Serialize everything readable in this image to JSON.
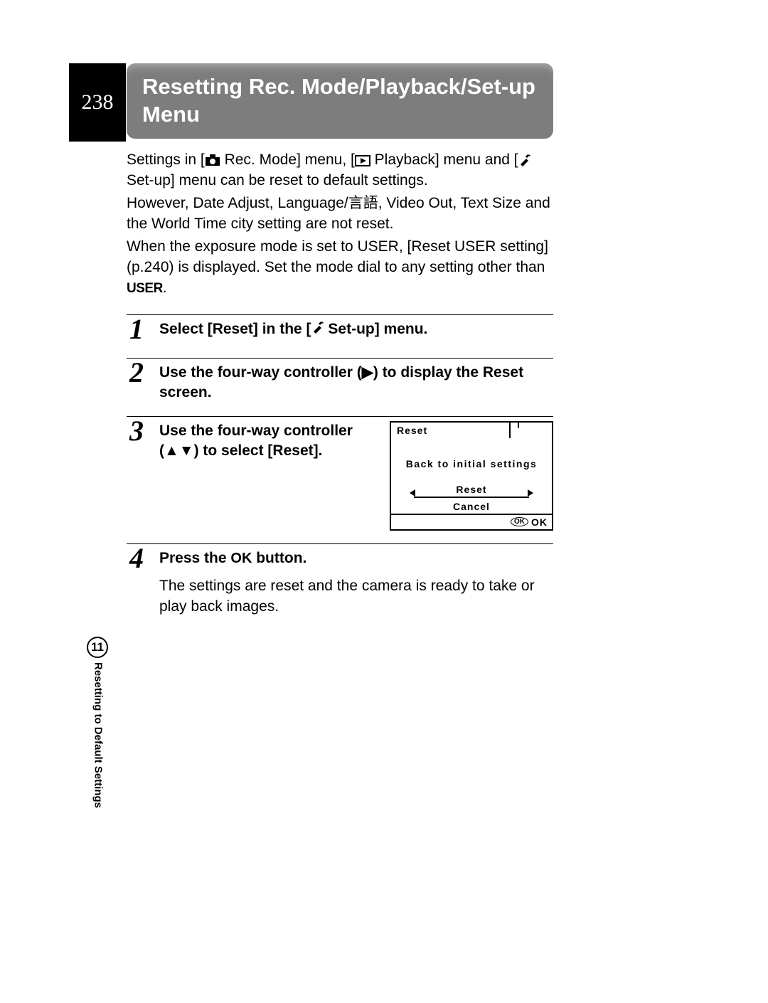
{
  "page_number": "238",
  "title": "Resetting Rec. Mode/Playback/Set-up Menu",
  "intro": {
    "part1": "Settings in [",
    "rec_mode": " Rec. Mode] menu, [",
    "playback": " Playback] menu and [",
    "setup": " Set-up] menu can be reset to default settings.",
    "para2": "However, Date Adjust, Language/言語, Video Out, Text Size and the World Time city setting are not reset.",
    "para3a": "When the exposure mode is set to USER, [Reset USER setting] (p.240) is displayed. Set the mode dial to any setting other than ",
    "user_label": "USER",
    "para3b": "."
  },
  "steps": [
    {
      "num": "1",
      "head_a": "Select [Reset] in the [",
      "head_b": " Set-up] menu."
    },
    {
      "num": "2",
      "head": "Use the four-way controller (▶) to display the Reset screen."
    },
    {
      "num": "3",
      "head": "Use the four-way controller (▲▼) to select [Reset]."
    },
    {
      "num": "4",
      "head_a": "Press the ",
      "ok": "OK",
      "head_b": " button.",
      "text": "The settings are reset and the camera is ready to take or play back images."
    }
  ],
  "reset_screen": {
    "tab": "Reset",
    "message": "Back to initial settings",
    "option_reset": "Reset",
    "option_cancel": "Cancel",
    "footer_ok_pill": "OK",
    "footer_ok": "OK"
  },
  "side": {
    "chapter": "11",
    "label": "Resetting to Default Settings"
  }
}
